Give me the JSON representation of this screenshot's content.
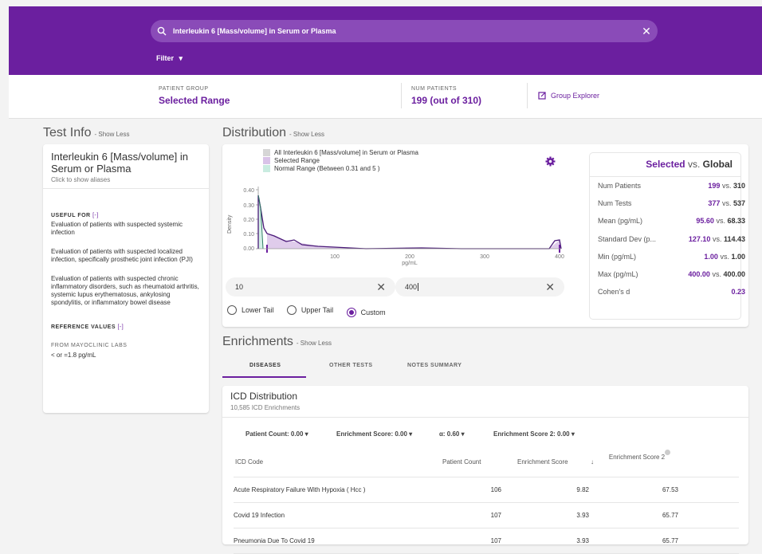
{
  "search": {
    "query": "Interleukin 6 [Mass/volume] in Serum or Plasma"
  },
  "filter": {
    "label": "Filter"
  },
  "summary": {
    "group_label": "PATIENT GROUP",
    "group_value": "Selected Range",
    "num_label": "NUM PATIENTS",
    "num_value": "199 (out of 310)",
    "explorer": "Group Explorer"
  },
  "testinfo": {
    "section": "Test Info",
    "show_less": "- Show Less",
    "title": "Interleukin 6 [Mass/volume] in Serum or Plasma",
    "aliases": "Click to show aliases",
    "useful_for_label": "USEFUL FOR",
    "useful_toggle": "[-]",
    "useful": [
      "Evaluation of patients with suspected systemic infection",
      "Evaluation of patients with suspected localized infection, specifically prosthetic joint infection (PJI)",
      "Evaluation of patients with suspected chronic inflammatory disorders, such as rheumatoid arthritis, systemic lupus erythematosus, ankylosing spondylitis, or inflammatory bowel disease"
    ],
    "ref_label": "REFERENCE VALUES",
    "ref_toggle": "[-]",
    "source_label": "FROM MAYOCLINIC LABS",
    "ref_value": "< or =1.8 pg/mL"
  },
  "distribution": {
    "section": "Distribution",
    "show_less": "- Show Less",
    "legend": [
      {
        "label": "All Interleukin 6 [Mass/volume] in Serum or Plasma",
        "color": "#d6d6d6"
      },
      {
        "label": "Selected Range",
        "color": "#d9c3e8"
      },
      {
        "label": "Normal Range (Between 0.31 and 5 )",
        "color": "#c9ece0"
      }
    ],
    "y_axis_label": "Density",
    "x_axis_label": "pg/mL",
    "y_ticks": [
      "0.40",
      "0.30",
      "0.20",
      "0.10",
      "0.00"
    ],
    "x_ticks": [
      "100",
      "200",
      "300",
      "400"
    ],
    "min_value": "10",
    "max_value": "400",
    "radios": [
      {
        "label": "Lower Tail",
        "selected": false
      },
      {
        "label": "Upper Tail",
        "selected": false
      },
      {
        "label": "Custom",
        "selected": true
      }
    ]
  },
  "stats": {
    "title_selected": "Selected",
    "title_rest": "vs.",
    "title_global": "Global",
    "rows": [
      {
        "key": "Num Patients",
        "selected": "199",
        "global": "310"
      },
      {
        "key": "Num Tests",
        "selected": "377",
        "global": "537"
      },
      {
        "key": "Mean (pg/mL)",
        "selected": "95.60",
        "global": "68.33"
      },
      {
        "key": "Standard Dev (p...",
        "selected": "127.10",
        "global": "114.43"
      },
      {
        "key": "Min (pg/mL)",
        "selected": "1.00",
        "global": "1.00"
      },
      {
        "key": "Max (pg/mL)",
        "selected": "400.00",
        "global": "400.00"
      },
      {
        "key": "Cohen's d",
        "selected": "0.23",
        "global": ""
      }
    ],
    "vs": "vs."
  },
  "enrichments": {
    "section": "Enrichments",
    "show_less": "- Show Less",
    "tabs": [
      "DISEASES",
      "OTHER TESTS",
      "NOTES SUMMARY"
    ],
    "icd_title": "ICD Distribution",
    "icd_sub": "10,585 ICD Enrichments",
    "filters": [
      "Patient Count: 0.00",
      "Enrichment Score: 0.00",
      "α: 0.60",
      "Enrichment Score 2: 0.00"
    ],
    "columns": [
      "ICD Code",
      "Patient Count",
      "Enrichment Score",
      "Enrichment Score 2"
    ],
    "rows": [
      {
        "code": "Acute Respiratory Failure With Hypoxia ( Hcc )",
        "count": "106",
        "score": "9.82",
        "score2": "67.53"
      },
      {
        "code": "Covid 19 Infection",
        "count": "107",
        "score": "3.93",
        "score2": "65.77"
      },
      {
        "code": "Pneumonia Due To Covid 19",
        "count": "107",
        "score": "3.93",
        "score2": "65.77"
      }
    ]
  },
  "colors": {
    "brand": "#6b1f9f",
    "selected_fill": "#d9c3e8",
    "normal_fill": "#c9ece0"
  }
}
